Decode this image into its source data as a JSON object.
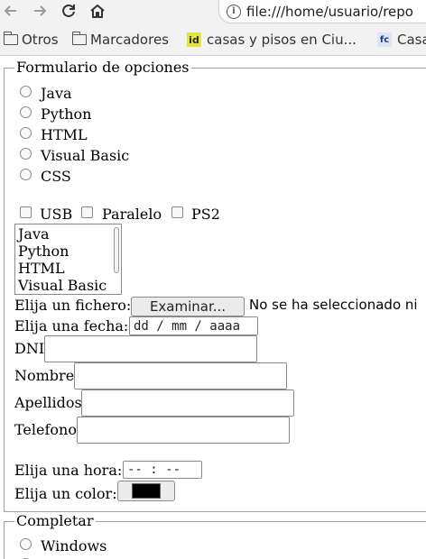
{
  "browser": {
    "url": "file:///home/usuario/repo",
    "bookmarks": [
      "Otros",
      "Marcadores",
      "casas y pisos en Ciu...",
      "Casa"
    ],
    "bookmark_icons": [
      "folder-icon",
      "folder-icon",
      "idealista-favicon",
      "fotocasa-favicon"
    ],
    "favicon_text": {
      "id": "id",
      "fc": "fc"
    }
  },
  "form": {
    "fieldset1_legend": "Formulario de opciones",
    "radios": [
      "Java",
      "Python",
      "HTML",
      "Visual Basic",
      "CSS"
    ],
    "checkboxes": [
      "USB",
      "Paralelo",
      "PS2"
    ],
    "listbox_options": [
      "Java",
      "Python",
      "HTML",
      "Visual Basic"
    ],
    "file_label": "Elija un fichero:",
    "file_button": "Examinar...",
    "file_status": "No se ha seleccionado ni",
    "date_label": "Elija una fecha:",
    "date_placeholder": "dd / mm / aaaa",
    "dni_label": "DNI",
    "nombre_label": "Nombre",
    "apellidos_label": "Apellidos",
    "telefono_label": "Telefono",
    "time_label": "Elija una hora:",
    "time_placeholder": "-- : --",
    "color_label": "Elija un color:",
    "color_value": "#000000",
    "fieldset2_legend": "Completar",
    "radio2": "Windows"
  }
}
